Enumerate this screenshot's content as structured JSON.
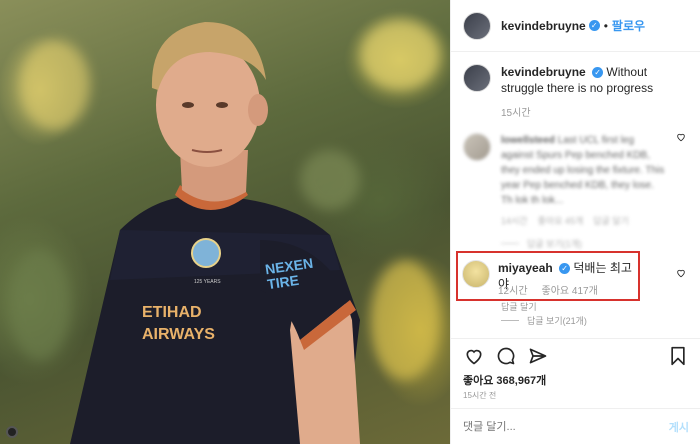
{
  "header": {
    "username": "kevindebruyne",
    "verified_glyph": "✓",
    "separator": "•",
    "follow_label": "팔로우"
  },
  "caption": {
    "username": "kevindebruyne",
    "text": "Without struggle there is no progress",
    "time": "15시간"
  },
  "blurred_comment": {
    "username": "lowellsteed",
    "text": "Last UCL first leg against Spurs Pep benched KDB, they ended up losing the fixture. This year Pep benched KDB, they lose. Th lok th lok...",
    "time": "14시간",
    "likes": "좋아요 45개",
    "reply": "답글 달기",
    "view_replies": "답글 보기(1개)"
  },
  "highlighted_comment": {
    "username": "miyayeah",
    "text": "덕배는 최고야",
    "time": "12시간",
    "likes": "좋아요 417개",
    "reply": "답글 달기",
    "view_replies": "답글 보기(21개)"
  },
  "post": {
    "likes_label": "좋아요 368,967개",
    "timestamp": "15시간 전"
  },
  "comment_box": {
    "placeholder": "댓글 달기...",
    "post_label": "게시"
  },
  "photo": {
    "jersey_sponsor": "ETIHAD AIRWAYS",
    "jersey_sleeve": "NEXEN TIRE",
    "crest_text": "125 YEARS"
  }
}
